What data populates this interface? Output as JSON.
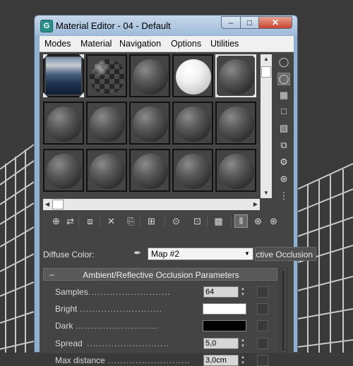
{
  "window": {
    "title": "Material Editor - 04 - Default",
    "app_icon": "G",
    "controls": {
      "minimize": "–",
      "maximize": "□",
      "close": "✕"
    }
  },
  "menu": [
    "Modes",
    "Material",
    "Navigation",
    "Options",
    "Utilities"
  ],
  "sample_slots": {
    "rows": 3,
    "columns": 5,
    "active_slot": 4,
    "slot_kinds": [
      "sky-map",
      "checker-sphere",
      "gray-sphere",
      "white-sphere",
      "gray-sphere",
      "gray-sphere",
      "gray-sphere",
      "gray-sphere",
      "gray-sphere",
      "gray-sphere",
      "gray-sphere",
      "gray-sphere",
      "gray-sphere",
      "gray-sphere",
      "gray-sphere"
    ],
    "scroll": {
      "up": "▲",
      "down": "▼",
      "left": "◀",
      "right": "▶"
    }
  },
  "side_tools": [
    {
      "icon": "sample-type-icon",
      "glyph": "◯",
      "selected": false
    },
    {
      "icon": "backlight-icon",
      "glyph": "◯",
      "selected": true
    },
    {
      "icon": "background-checker-icon",
      "glyph": "▦",
      "selected": false
    },
    {
      "icon": "sample-uv-tiling-icon",
      "glyph": "□",
      "selected": false
    },
    {
      "icon": "video-color-check-icon",
      "glyph": "▧",
      "selected": false
    },
    {
      "icon": "make-preview-icon",
      "glyph": "⧉",
      "selected": false
    },
    {
      "icon": "options-icon",
      "glyph": "⚙",
      "selected": false
    },
    {
      "icon": "select-by-material-icon",
      "glyph": "⊛",
      "selected": false
    },
    {
      "icon": "material-map-navigator-icon",
      "glyph": "⋮",
      "selected": false
    }
  ],
  "toolbar": [
    {
      "icon": "get-material-icon",
      "glyph": "⊕"
    },
    {
      "icon": "put-to-scene-icon",
      "glyph": "⇄"
    },
    {
      "icon": "assign-to-selection-icon",
      "glyph": "⧈"
    },
    {
      "icon": "reset-map-icon",
      "glyph": "✕"
    },
    {
      "icon": "make-copy-icon",
      "glyph": "⎘"
    },
    {
      "icon": "make-unique-icon",
      "glyph": "⊞"
    },
    {
      "icon": "put-to-library-icon",
      "glyph": "⊙"
    },
    {
      "icon": "material-id-channel-icon",
      "glyph": "⊡"
    },
    {
      "icon": "show-shaded-in-viewport-icon",
      "glyph": "▩"
    },
    {
      "icon": "show-end-result-icon",
      "glyph": "⫴"
    },
    {
      "icon": "go-to-parent-icon",
      "glyph": "⊛"
    },
    {
      "icon": "go-forward-to-sibling-icon",
      "glyph": "⊛"
    }
  ],
  "diffuse": {
    "label": "Diffuse Color:",
    "eyedropper_glyph": "✒",
    "map_name": "Map #2",
    "map_type": "Ambient/Reflective Occlusion",
    "dropdown_glyph": "▼"
  },
  "rollout": {
    "collapse_sign": "–",
    "title": "Ambient/Reflective Occlusion Parameters",
    "dot_leader": "...........................",
    "params": [
      {
        "label": "Samples",
        "kind": "value",
        "value": "64"
      },
      {
        "label": "Bright",
        "kind": "swatch",
        "color": "#ffffff"
      },
      {
        "label": "Dark",
        "kind": "swatch",
        "color": "#000000"
      },
      {
        "label": "Spread",
        "kind": "value",
        "value": "5,0"
      },
      {
        "label": "Max distance",
        "kind": "value",
        "value": "3,0cm"
      }
    ]
  }
}
